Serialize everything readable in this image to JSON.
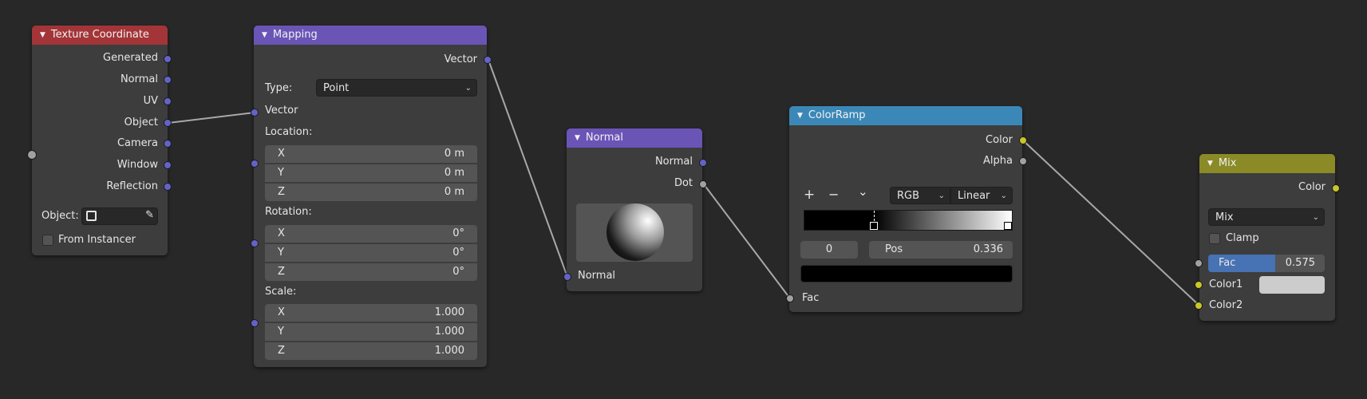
{
  "colors": {
    "background": "#282828",
    "node_body": "#3d3d3d",
    "header_input": "#a33538",
    "header_vector": "#6a55b7",
    "header_converter": "#3b88b8",
    "header_color": "#8a8a27",
    "socket_vector": "#6363c7",
    "socket_float": "#a1a1a1",
    "socket_color": "#c7c729",
    "fac_slider": "#4772b3"
  },
  "texture_coordinate": {
    "title": "Texture Coordinate",
    "outputs": [
      "Generated",
      "Normal",
      "UV",
      "Object",
      "Camera",
      "Window",
      "Reflection"
    ],
    "object_label": "Object:",
    "from_instancer_label": "From Instancer"
  },
  "mapping": {
    "title": "Mapping",
    "output_vector": "Vector",
    "type_label": "Type:",
    "type_value": "Point",
    "input_vector": "Vector",
    "location_label": "Location:",
    "location": [
      {
        "axis": "X",
        "value": "0 m"
      },
      {
        "axis": "Y",
        "value": "0 m"
      },
      {
        "axis": "Z",
        "value": "0 m"
      }
    ],
    "rotation_label": "Rotation:",
    "rotation": [
      {
        "axis": "X",
        "value": "0°"
      },
      {
        "axis": "Y",
        "value": "0°"
      },
      {
        "axis": "Z",
        "value": "0°"
      }
    ],
    "scale_label": "Scale:",
    "scale": [
      {
        "axis": "X",
        "value": "1.000"
      },
      {
        "axis": "Y",
        "value": "1.000"
      },
      {
        "axis": "Z",
        "value": "1.000"
      }
    ]
  },
  "normal": {
    "title": "Normal",
    "out_normal": "Normal",
    "out_dot": "Dot",
    "in_normal": "Normal"
  },
  "colorramp": {
    "title": "ColorRamp",
    "out_color": "Color",
    "out_alpha": "Alpha",
    "add_symbol": "+",
    "remove_symbol": "−",
    "menu_symbol": "⌄",
    "color_mode": "RGB",
    "interpolation": "Linear",
    "active_stop": "0",
    "pos_label": "Pos",
    "pos_value": "0.336",
    "stop_positions": [
      0.336,
      1.0
    ],
    "in_fac": "Fac"
  },
  "mix": {
    "title": "Mix",
    "out_color": "Color",
    "blend_type": "Mix",
    "clamp_label": "Clamp",
    "fac_label": "Fac",
    "fac_value": "0.575",
    "fac_fraction": 0.575,
    "color1_label": "Color1",
    "color2_label": "Color2"
  }
}
